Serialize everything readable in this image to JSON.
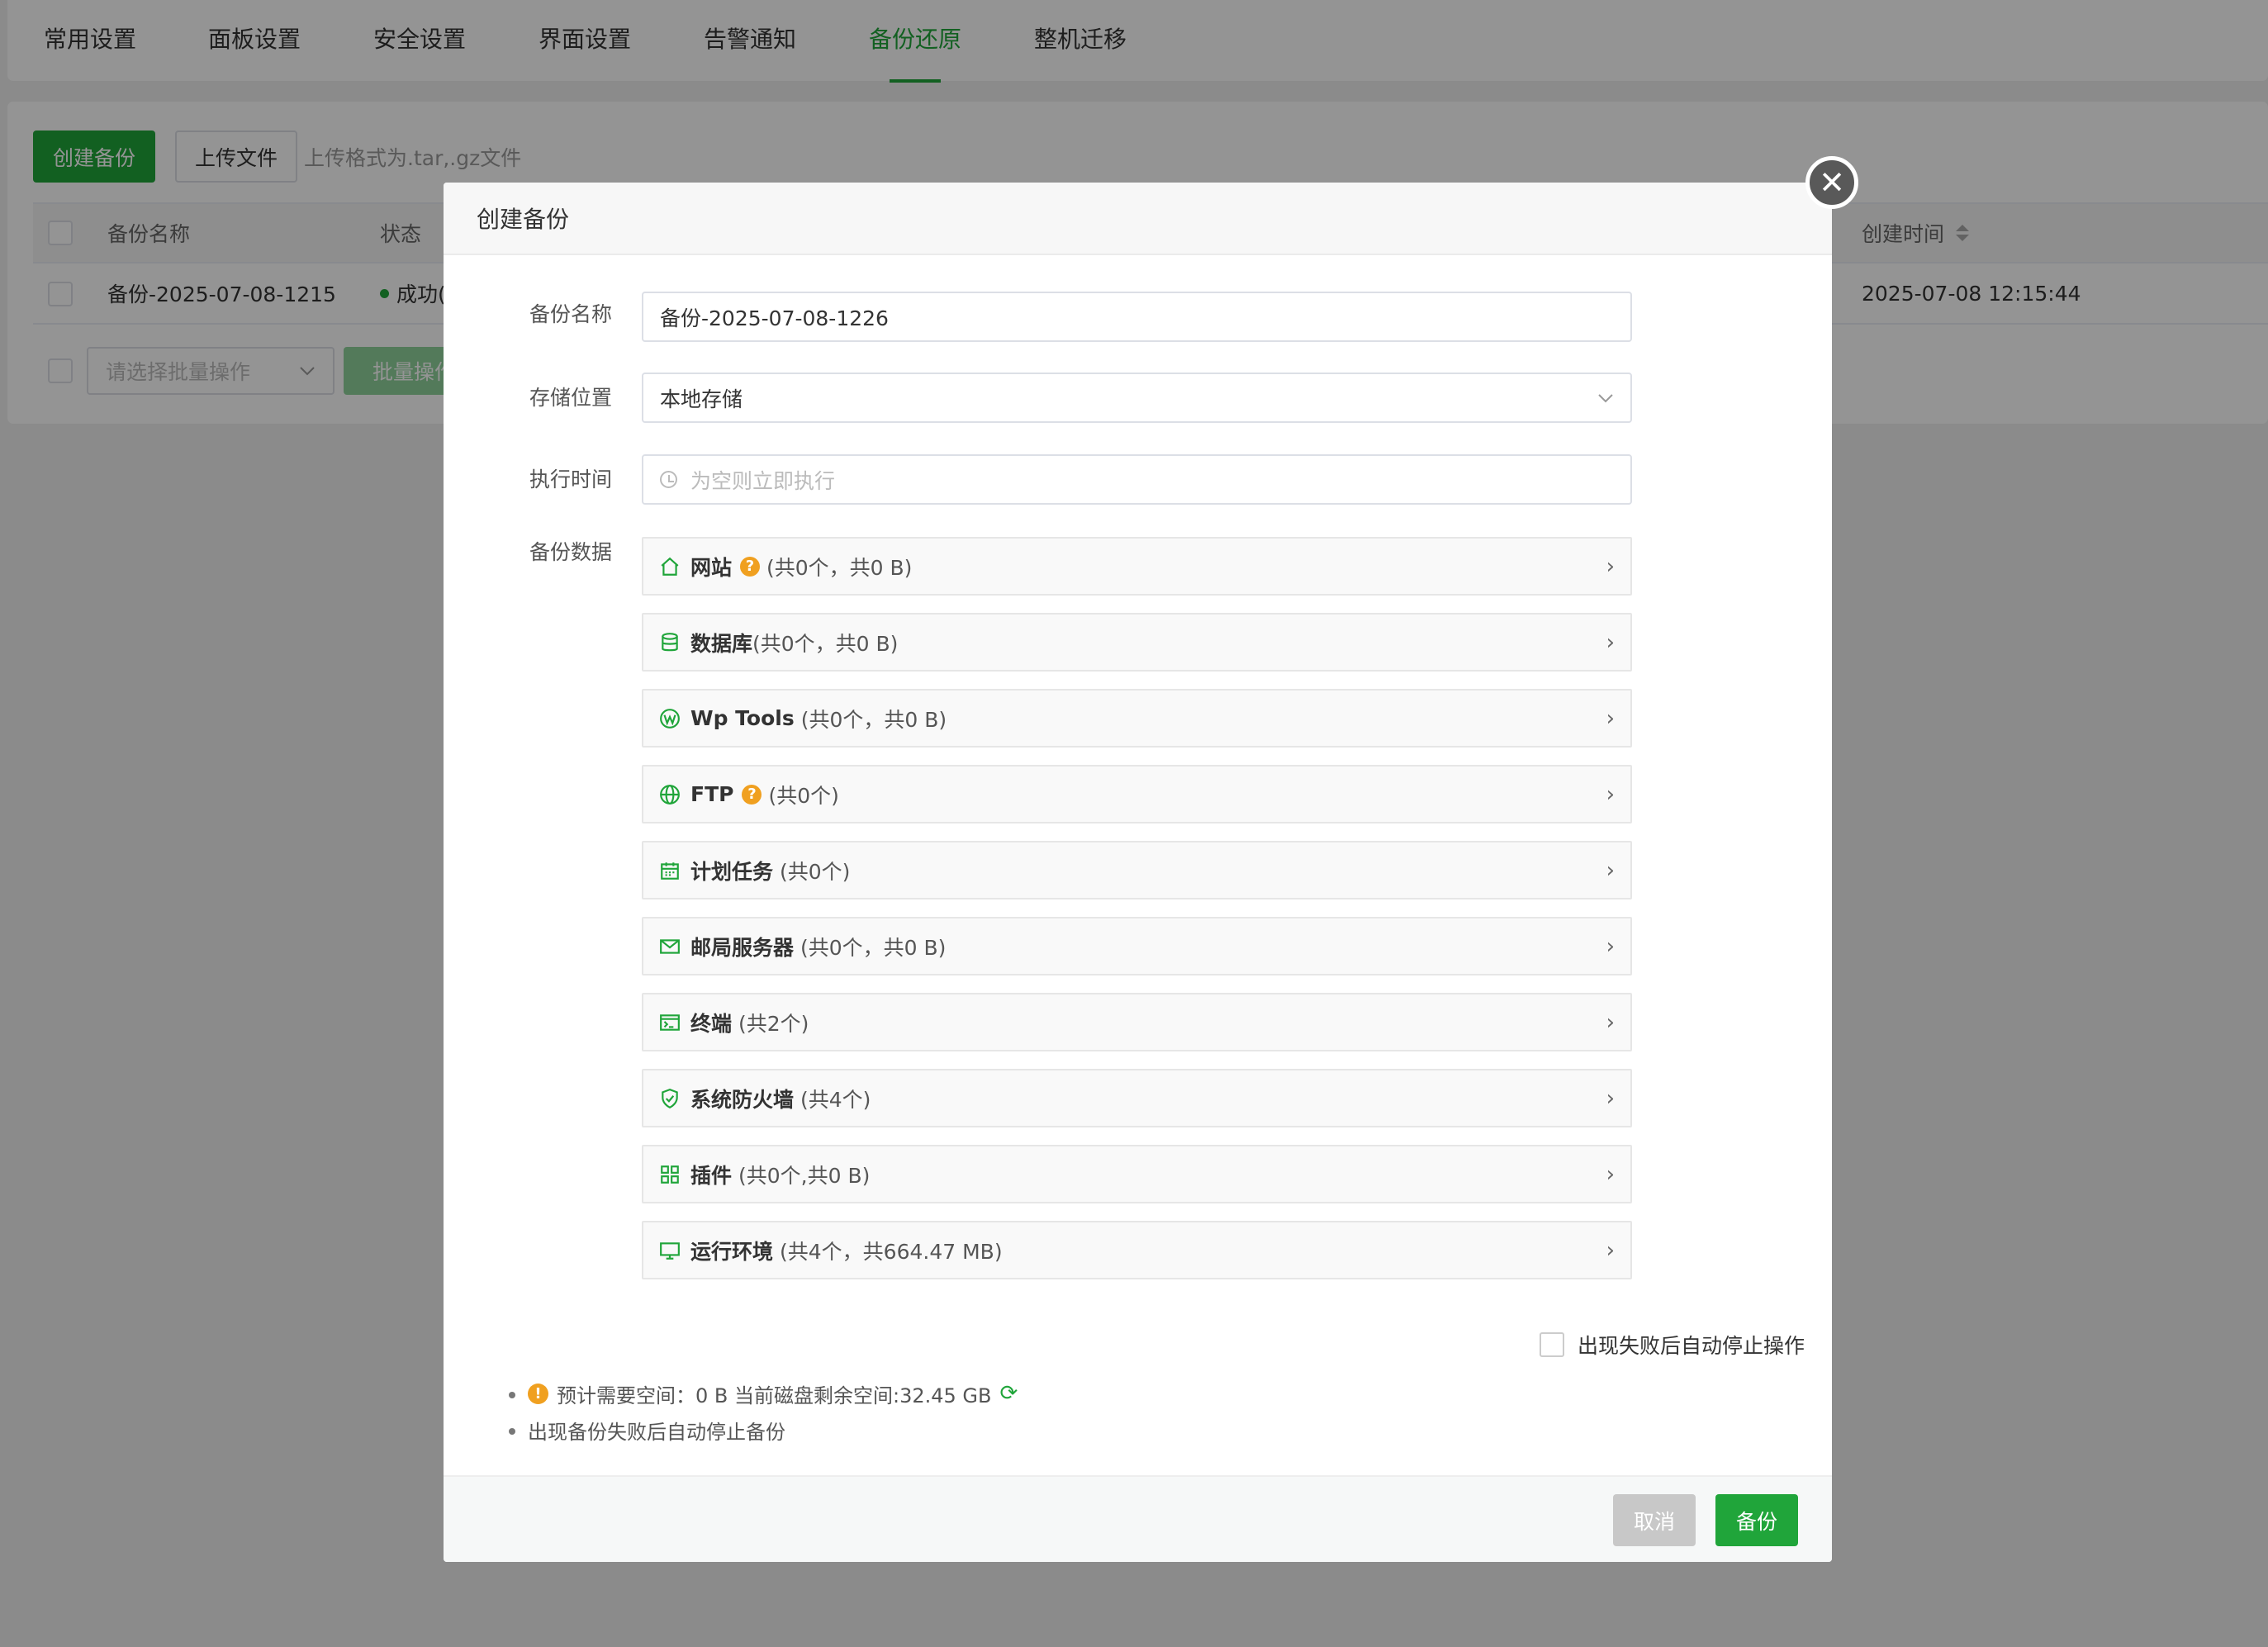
{
  "nav": {
    "tabs": [
      "常用设置",
      "面板设置",
      "安全设置",
      "界面设置",
      "告警通知",
      "备份还原",
      "整机迁移"
    ],
    "active_tab": "备份还原"
  },
  "toolbar": {
    "create_backup": "创建备份",
    "upload_file": "上传文件",
    "upload_hint": "上传格式为.tar,.gz文件"
  },
  "table": {
    "headers": {
      "name": "备份名称",
      "status": "状态",
      "created": "创建时间"
    },
    "rows": [
      {
        "name": "备份-2025-07-08-1215",
        "status": "成功(",
        "created": "2025-07-08 12:15:44"
      }
    ],
    "batch_placeholder": "请选择批量操作",
    "batch_button": "批量操作"
  },
  "modal": {
    "title": "创建备份",
    "fields": {
      "name_label": "备份名称",
      "name_value": "备份-2025-07-08-1226",
      "storage_label": "存储位置",
      "storage_value": "本地存储",
      "time_label": "执行时间",
      "time_placeholder": "为空则立即执行",
      "data_label": "备份数据"
    },
    "data_items": [
      {
        "icon": "home-icon",
        "name": "网站",
        "help": true,
        "info": "(共0个，共0 B)"
      },
      {
        "icon": "database-icon",
        "name": "数据库",
        "help": false,
        "info": "(共0个，共0 B)"
      },
      {
        "icon": "wordpress-icon",
        "name": "Wp Tools",
        "help": false,
        "info": "(共0个，共0 B)"
      },
      {
        "icon": "globe-icon",
        "name": "FTP",
        "help": true,
        "info": "(共0个)"
      },
      {
        "icon": "calendar-icon",
        "name": "计划任务",
        "help": false,
        "info": "(共0个)"
      },
      {
        "icon": "mail-icon",
        "name": "邮局服务器",
        "help": false,
        "info": "(共0个，共0 B)"
      },
      {
        "icon": "terminal-icon",
        "name": "终端",
        "help": false,
        "info": "(共2个)"
      },
      {
        "icon": "shield-icon",
        "name": "系统防火墙",
        "help": false,
        "info": "(共4个)"
      },
      {
        "icon": "plugins-icon",
        "name": "插件",
        "help": false,
        "info": "(共0个,共0 B)"
      },
      {
        "icon": "monitor-icon",
        "name": "运行环境",
        "help": false,
        "info": "(共4个，共664.47 MB)"
      }
    ],
    "auto_stop_label": "出现失败后自动停止操作",
    "notes": {
      "space": "预计需要空间：0 B 当前磁盘剩余空间:32.45 GB",
      "auto_stop": "出现备份失败后自动停止备份"
    },
    "buttons": {
      "cancel": "取消",
      "confirm": "备份"
    }
  },
  "colors": {
    "accent": "#20a53a",
    "warning": "#f0a020"
  }
}
